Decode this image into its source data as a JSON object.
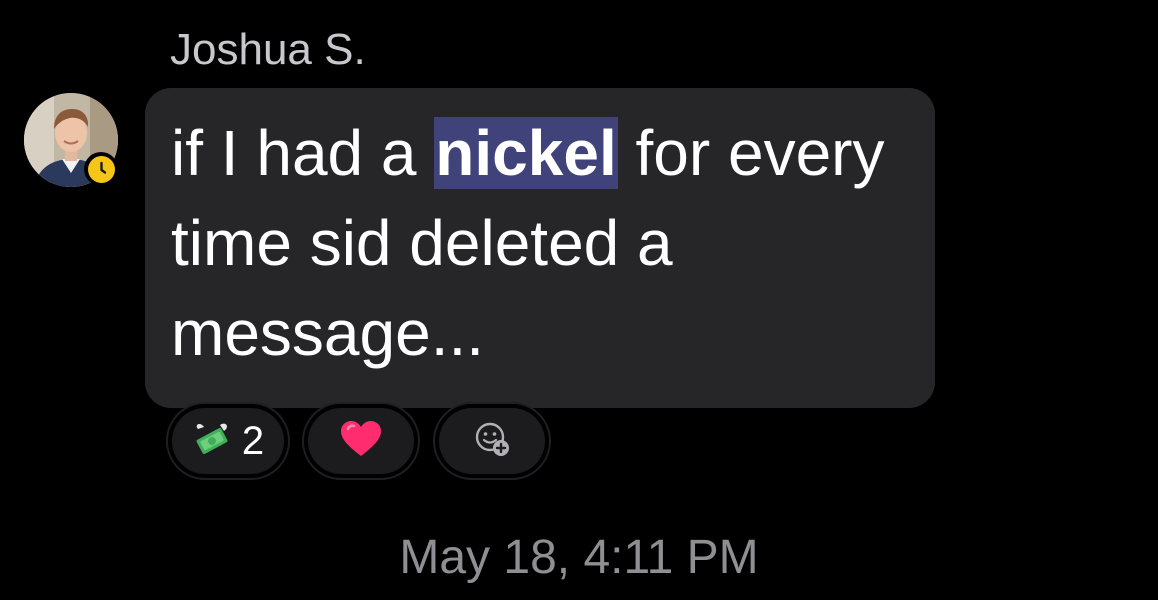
{
  "message": {
    "sender_name": "Joshua S.",
    "text_before": "if I had a ",
    "highlighted_word": "nickel",
    "text_after": " for every time sid deleted a message...",
    "avatar_icon": "profile-photo",
    "status_icon": "clock-icon",
    "status_color": "#f5c518",
    "highlight_color": "#40427a",
    "bubble_color": "#262628"
  },
  "reactions": [
    {
      "icon": "money-with-wings-icon",
      "count": "2"
    },
    {
      "icon": "heart-icon",
      "count": ""
    },
    {
      "icon": "add-reaction-icon",
      "count": ""
    }
  ],
  "timestamp": "May 18, 4:11 PM"
}
